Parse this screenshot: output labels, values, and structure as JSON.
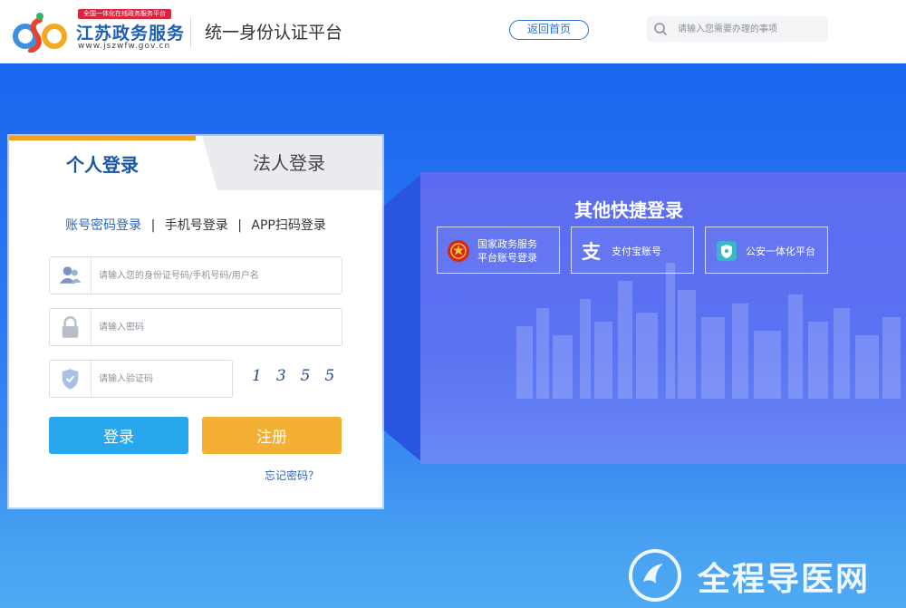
{
  "header": {
    "badge": "全国一体化在线政务服务平台",
    "logo_title": "江苏政务服务",
    "logo_url": "www.jszwfw.gov.cn",
    "platform_title": "统一身份认证平台",
    "home_button": "返回首页",
    "search_placeholder": "请输入您需要办理的事项"
  },
  "login": {
    "tabs": [
      "个人登录",
      "法人登录"
    ],
    "active_tab": "个人登录",
    "methods": [
      "账号密码登录",
      "手机号登录",
      "APP扫码登录"
    ],
    "method_separator": "|",
    "username_placeholder": "请输入您的身份证号码/手机号码/用户名",
    "password_placeholder": "请输入密码",
    "captcha_placeholder": "请输入验证码",
    "captcha_text": "1355",
    "login_button": "登录",
    "register_button": "注册",
    "forgot_link": "忘记密码？"
  },
  "quick_login": {
    "title": "其他快捷登录",
    "options": [
      {
        "label": "国家政务服务\n平台账号登录",
        "icon": "national-emblem-icon"
      },
      {
        "label": "支付宝账号",
        "icon": "alipay-icon"
      },
      {
        "label": "公安一体化平台",
        "icon": "police-shield-icon"
      }
    ]
  },
  "watermark": {
    "text": "全程导医网"
  },
  "colors": {
    "background_blue": "#1f6ff0",
    "active_tab_accent": "#f0a020",
    "login_button": "#27a8ee",
    "register_button": "#f3b033",
    "link_blue": "#2a64c0"
  }
}
